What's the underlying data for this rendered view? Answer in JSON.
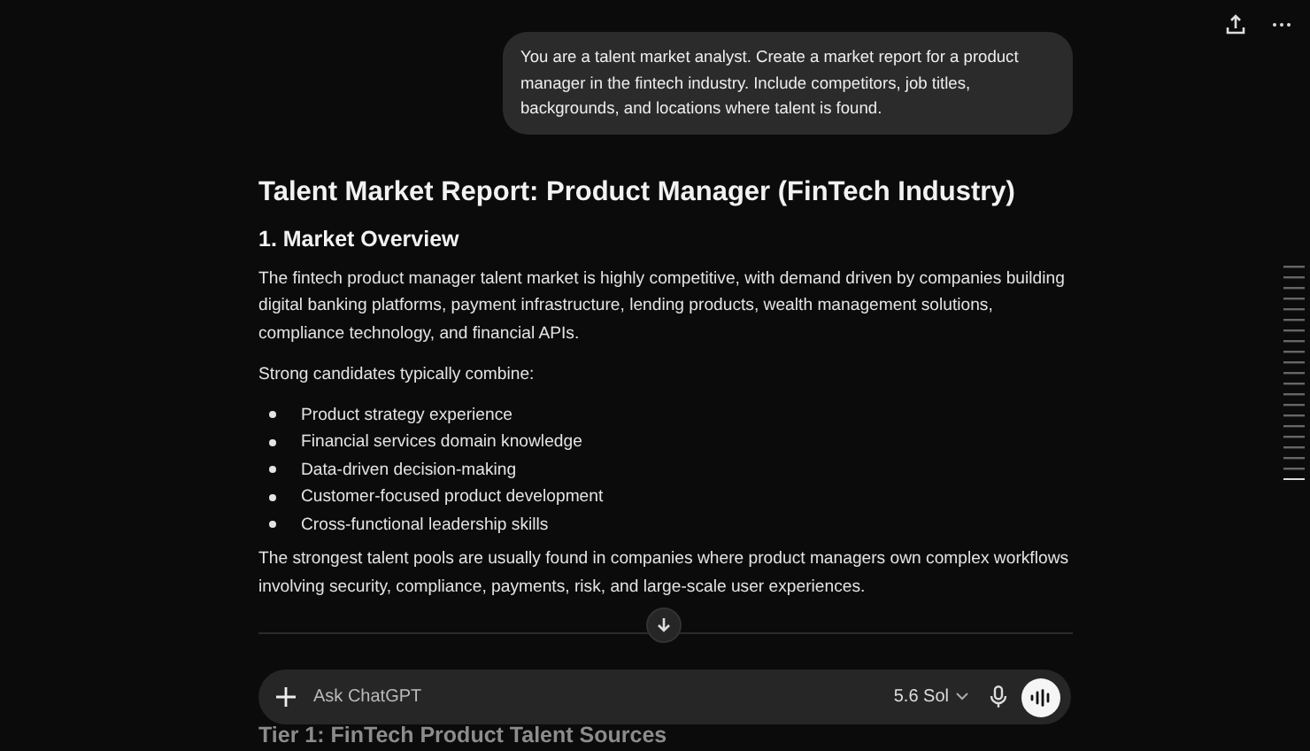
{
  "user_message": "You are a talent market analyst. Create a market report for a product manager in the fintech industry. Include competitors, job titles, backgrounds, and locations where talent is found.",
  "report": {
    "title": "Talent Market Report: Product Manager (FinTech Industry)",
    "section": "1. Market Overview",
    "intro": "The fintech product manager talent market is highly competitive, with demand driven by companies building digital banking platforms, payment infrastructure, lending products, wealth management solutions, compliance technology, and financial APIs.",
    "lead": "Strong candidates typically combine:",
    "bullets": [
      "Product strategy experience",
      "Financial services domain knowledge",
      "Data-driven decision-making",
      "Customer-focused product development",
      "Cross-functional leadership skills"
    ],
    "closing": "The strongest talent pools are usually found in companies where product managers own complex workflows involving security, compliance, payments, risk, and large-scale user experiences.",
    "next_heading": "Tier 1: FinTech Product Talent Sources"
  },
  "composer": {
    "placeholder": "Ask ChatGPT",
    "model": "5.6 Sol"
  }
}
